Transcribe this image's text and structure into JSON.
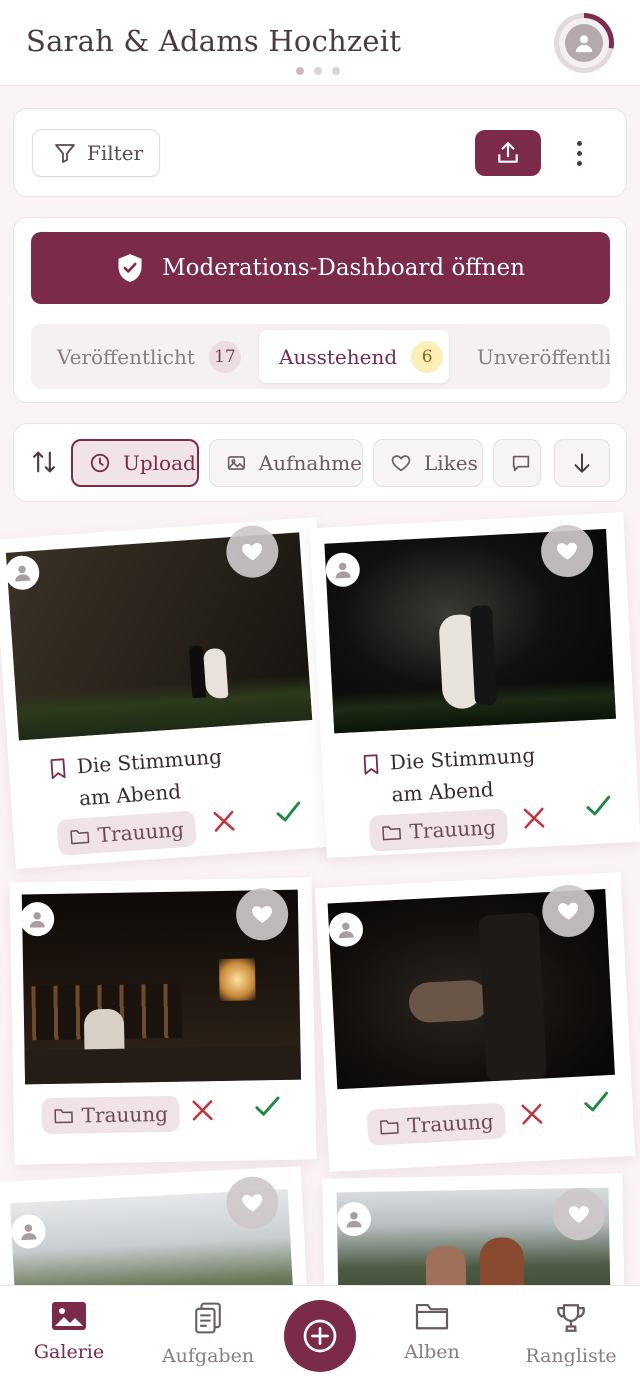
{
  "header": {
    "title": "Sarah & Adams Hochzeit",
    "avatar_icon": "user-icon",
    "accent": "#7b2a4a"
  },
  "toolbar": {
    "filter_label": "Filter",
    "upload_icon": "upload-icon",
    "more_icon": "more-vertical-icon"
  },
  "moderation": {
    "dashboard_label": "Moderations-Dashboard öffnen",
    "tabs": [
      {
        "label": "Veröffentlicht",
        "count": "17",
        "active": false
      },
      {
        "label": "Ausstehend",
        "count": "6",
        "active": true
      },
      {
        "label": "Unveröffentlic",
        "count": "",
        "active": false
      }
    ]
  },
  "sort": {
    "chips": [
      {
        "label": "Upload",
        "icon": "clock-icon",
        "active": true
      },
      {
        "label": "Aufnahme",
        "icon": "image-icon",
        "active": false
      },
      {
        "label": "Likes",
        "icon": "heart-icon",
        "active": false
      },
      {
        "label": "",
        "icon": "comment-icon",
        "active": false
      }
    ],
    "direction_icon": "arrow-down-icon"
  },
  "gallery": {
    "items": [
      {
        "caption": "Die Stimmung am Abend",
        "album": "Trauung"
      },
      {
        "caption": "Die Stimmung am Abend",
        "album": "Trauung"
      },
      {
        "caption": "",
        "album": "Trauung"
      },
      {
        "caption": "",
        "album": "Trauung"
      },
      {
        "caption": "",
        "album": ""
      },
      {
        "caption": "",
        "album": ""
      }
    ]
  },
  "bottom_nav": {
    "items": [
      {
        "label": "Galerie",
        "icon": "gallery-icon",
        "active": true
      },
      {
        "label": "Aufgaben",
        "icon": "clipboard-icon",
        "active": false
      },
      {
        "label": "Alben",
        "icon": "folder-icon",
        "active": false
      },
      {
        "label": "Rangliste",
        "icon": "trophy-icon",
        "active": false
      }
    ],
    "fab_icon": "plus-circle-icon"
  }
}
